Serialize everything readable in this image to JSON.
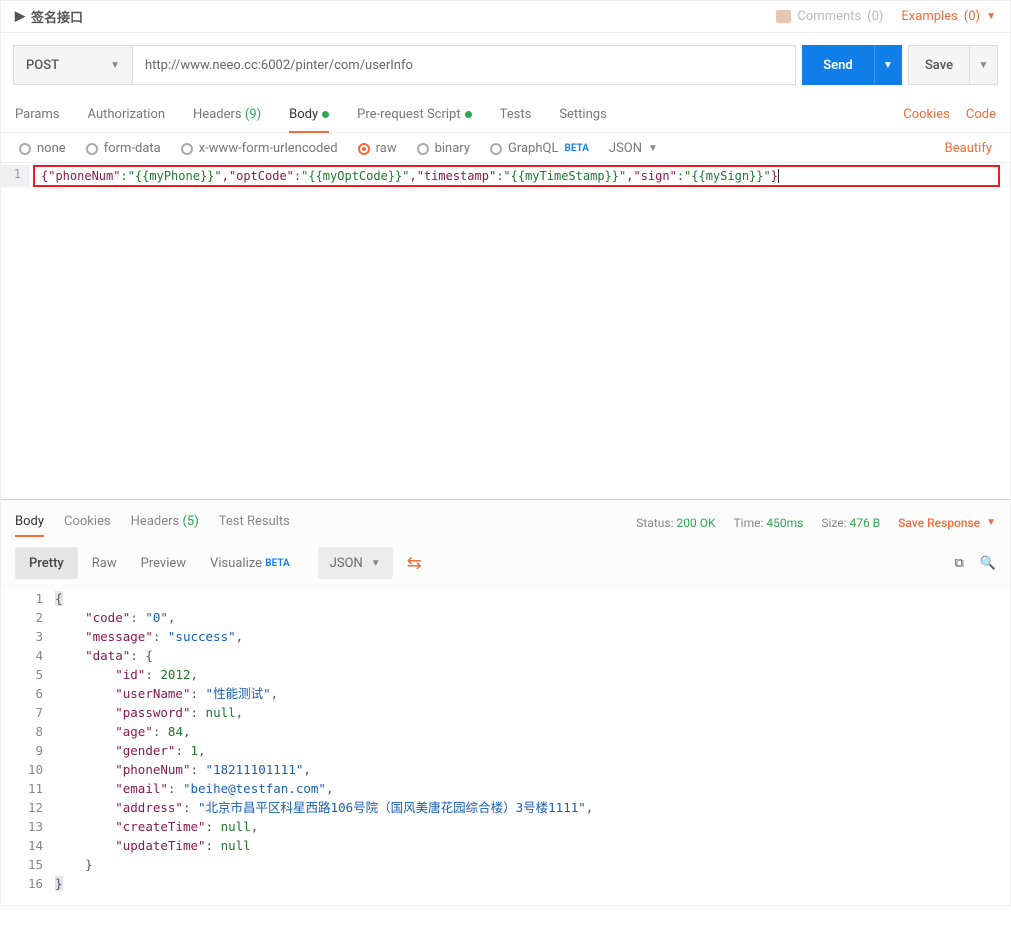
{
  "title": "签名接口",
  "comments": {
    "label": "Comments",
    "count": "(0)"
  },
  "examples": {
    "label": "Examples",
    "count": "(0)"
  },
  "method": "POST",
  "url": "http://www.neeo.cc:6002/pinter/com/userInfo",
  "send": "Send",
  "save": "Save",
  "tabs": {
    "params": "Params",
    "auth": "Authorization",
    "headers": "Headers",
    "headers_count": "(9)",
    "body": "Body",
    "prerequest": "Pre-request Script",
    "tests": "Tests",
    "settings": "Settings"
  },
  "right_links": {
    "cookies": "Cookies",
    "code": "Code"
  },
  "body_opts": {
    "none": "none",
    "form": "form-data",
    "urlenc": "x-www-form-urlencoded",
    "raw": "raw",
    "binary": "binary",
    "graphql": "GraphQL",
    "beta": "BETA",
    "json": "JSON"
  },
  "beautify": "Beautify",
  "request_body_line": "1",
  "request_body_tokens": {
    "t1": "{\"phoneNum\"",
    "v1": ":\"{{myPhone}}\"",
    "t2": ",\"optCode\"",
    "v2": ":\"{{myOptCode}}\"",
    "t3": ",\"timestamp\"",
    "v3": ":\"{{myTimeStamp}}\"",
    "t4": ",\"sign\"",
    "v4": ":\"{{mySign}}\"",
    "end": "}"
  },
  "resp_tabs": {
    "body": "Body",
    "cookies": "Cookies",
    "headers": "Headers",
    "headers_count": "(5)",
    "tests": "Test Results"
  },
  "status": {
    "status_lbl": "Status:",
    "status_val": "200 OK",
    "time_lbl": "Time:",
    "time_val": "450ms",
    "size_lbl": "Size:",
    "size_val": "476 B"
  },
  "save_response": "Save Response",
  "view_modes": {
    "pretty": "Pretty",
    "raw": "Raw",
    "preview": "Preview",
    "visualize": "Visualize",
    "beta": "BETA",
    "format": "JSON"
  },
  "response_lines": [
    "1",
    "2",
    "3",
    "4",
    "5",
    "6",
    "7",
    "8",
    "9",
    "10",
    "11",
    "12",
    "13",
    "14",
    "15",
    "16"
  ],
  "response_json": {
    "code": "0",
    "message": "success",
    "data": {
      "id": 2012,
      "userName": "性能测试",
      "password": null,
      "age": 84,
      "gender": 1,
      "phoneNum": "18211101111",
      "email": "beihe@testfan.com",
      "address": "北京市昌平区科星西路106号院（国风美唐花园综合楼）3号楼1111",
      "createTime": null,
      "updateTime": null
    }
  }
}
